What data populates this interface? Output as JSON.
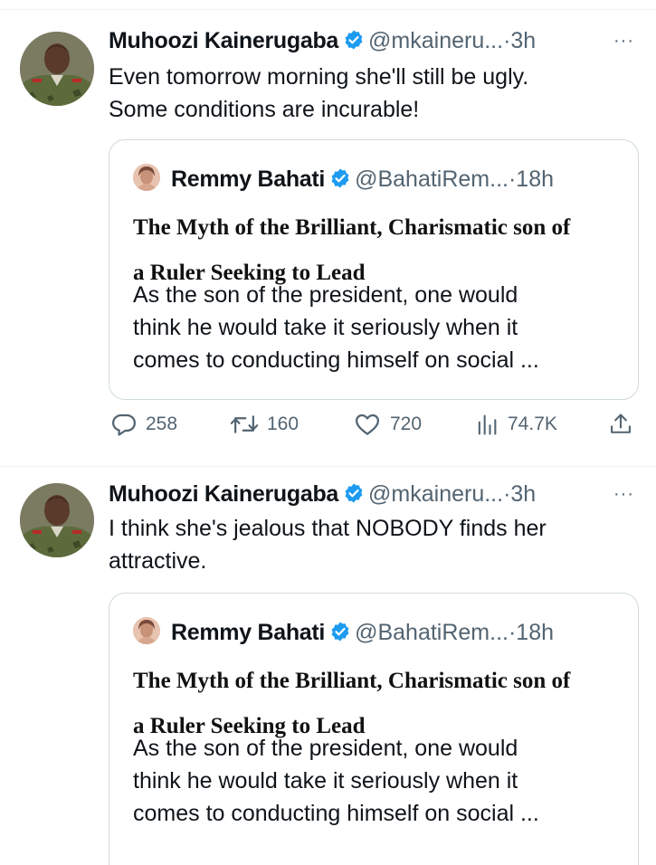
{
  "tweets": [
    {
      "author": "Muhoozi Kainerugaba",
      "handle": "@mkaineru...",
      "separator": "·",
      "time": "3h",
      "more": "···",
      "text_lines": [
        "Even tomorrow morning she'll still be ugly.",
        "Some conditions are incurable!"
      ],
      "quote": {
        "author": "Remmy Bahati",
        "handle": "@BahatiRem...",
        "separator": "·",
        "time": "18h",
        "title_lines": [
          "The Myth of the Brilliant, Charismatic son of",
          "a Ruler Seeking to Lead"
        ],
        "body_lines": [
          "As the son of the president, one would",
          "think he would take it seriously when it",
          "comes to conducting himself on social ..."
        ]
      },
      "actions": {
        "replies": "258",
        "retweets": "160",
        "likes": "720",
        "views": "74.7K"
      }
    },
    {
      "author": "Muhoozi Kainerugaba",
      "handle": "@mkaineru...",
      "separator": "·",
      "time": "3h",
      "more": "···",
      "text_lines": [
        "I think she's jealous that NOBODY finds her",
        "attractive."
      ],
      "quote": {
        "author": "Remmy Bahati",
        "handle": "@BahatiRem...",
        "separator": "·",
        "time": "18h",
        "title_lines": [
          "The Myth of the Brilliant, Charismatic son of",
          "a Ruler Seeking to Lead"
        ],
        "body_lines": [
          "As the son of the president, one would",
          "think he would take it seriously when it",
          "comes to conducting himself on social ..."
        ]
      }
    }
  ],
  "colors": {
    "verified": "#1d9bf0",
    "secondary_text": "#536471",
    "border": "#cfd9de"
  },
  "icons": [
    "verified-badge-icon",
    "more-icon",
    "reply-icon",
    "retweet-icon",
    "like-icon",
    "views-icon",
    "share-icon"
  ]
}
